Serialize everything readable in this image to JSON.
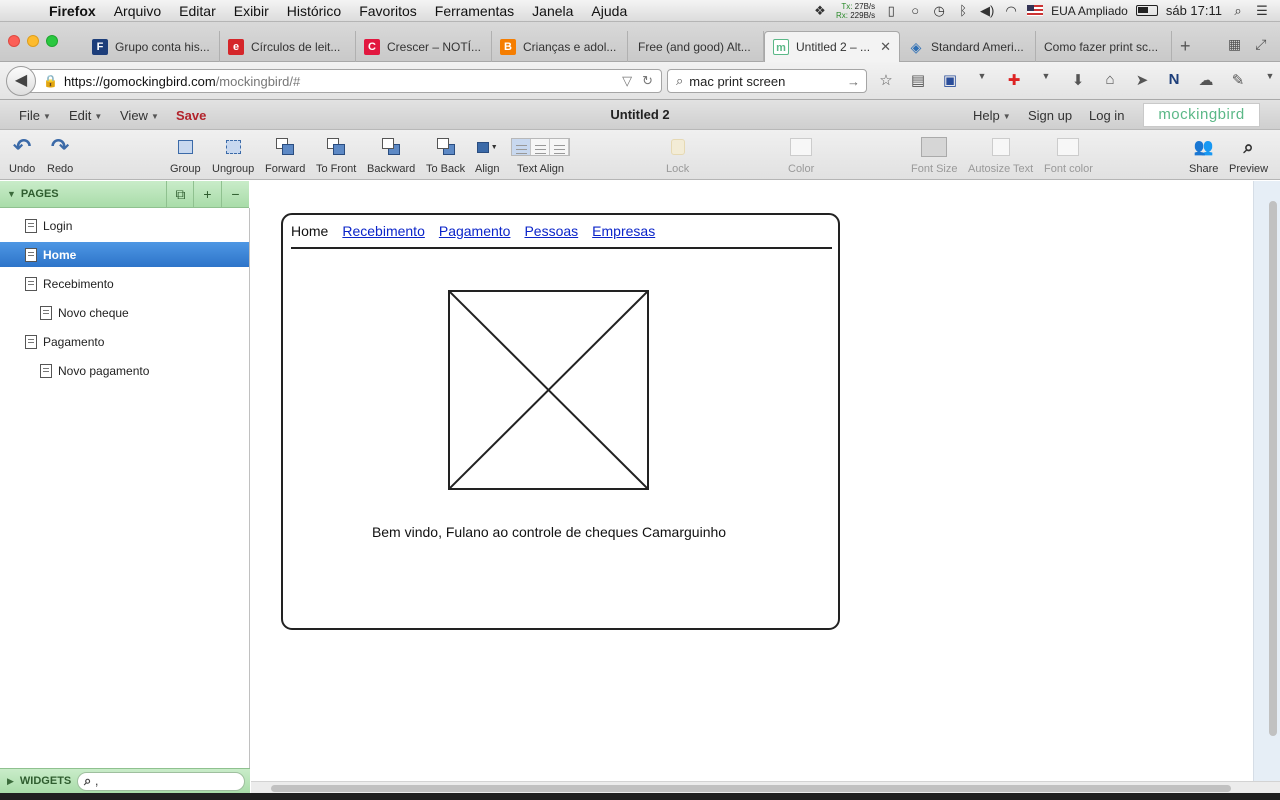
{
  "mac_menubar": {
    "app": "Firefox",
    "items": [
      "Arquivo",
      "Editar",
      "Exibir",
      "Histórico",
      "Favoritos",
      "Ferramentas",
      "Janela",
      "Ajuda"
    ],
    "net_tx_label": "Tx:",
    "net_rx_label": "Rx:",
    "net_tx": "27B/s",
    "net_rx": "229B/s",
    "keyboard": "EUA Ampliado",
    "clock": "sáb 17:11"
  },
  "tabs": [
    {
      "title": "Grupo conta his...",
      "favicon_text": "F",
      "favicon_color": "#1d3e7a"
    },
    {
      "title": "Círculos de leit...",
      "favicon_text": "e",
      "favicon_color": "#d5262a"
    },
    {
      "title": "Crescer – NOTÍ...",
      "favicon_text": "C",
      "favicon_color": "#e2173f"
    },
    {
      "title": "Crianças e adol...",
      "favicon_text": "B",
      "favicon_color": "#f57d00"
    },
    {
      "title": "Free (and good) Alt...",
      "favicon_text": "",
      "favicon_color": ""
    },
    {
      "title": "Untitled 2 – ...",
      "favicon_text": "m",
      "favicon_color": "#5bb887",
      "active": true
    },
    {
      "title": "Standard Ameri...",
      "favicon_text": "◈",
      "favicon_color": "#2e6fb5"
    },
    {
      "title": "Como fazer print sc...",
      "favicon_text": "",
      "favicon_color": ""
    }
  ],
  "tab_close": "✕",
  "new_tab": "+",
  "url": {
    "host": "https://gomockingbird.com",
    "path": "/mockingbird/#"
  },
  "search": {
    "value": "mac print screen"
  },
  "app_menu": {
    "file": "File",
    "edit": "Edit",
    "view": "View",
    "save": "Save",
    "doc_title": "Untitled 2",
    "help": "Help",
    "signup": "Sign up",
    "login": "Log in",
    "brand": "mockingbird"
  },
  "toolbar": {
    "undo": "Undo",
    "redo": "Redo",
    "group": "Group",
    "ungroup": "Ungroup",
    "forward": "Forward",
    "to_front": "To Front",
    "backward": "Backward",
    "to_back": "To Back",
    "align": "Align",
    "text_align": "Text Align",
    "lock": "Lock",
    "color": "Color",
    "font_size": "Font Size",
    "autosize_text": "Autosize Text",
    "font_color": "Font color",
    "share": "Share",
    "preview": "Preview"
  },
  "pages_panel": {
    "title": "PAGES",
    "add": "+",
    "remove": "−",
    "items": [
      {
        "label": "Login",
        "level": 0
      },
      {
        "label": "Home",
        "level": 0,
        "active": true
      },
      {
        "label": "Recebimento",
        "level": 0
      },
      {
        "label": "Novo cheque",
        "level": 1
      },
      {
        "label": "Pagamento",
        "level": 0
      },
      {
        "label": "Novo pagamento",
        "level": 1
      }
    ]
  },
  "widgets_panel": {
    "title": "WIDGETS",
    "search_value": ","
  },
  "mockup": {
    "nav_current": "Home",
    "nav_links": [
      "Recebimento",
      "Pagamento",
      "Pessoas",
      "Empresas"
    ],
    "welcome_text": "Bem vindo, Fulano ao controle de cheques Camarguinho"
  },
  "colors": {
    "accent_blue": "#2d74c9",
    "panel_green": "#a9dca9",
    "save_red": "#b2232b",
    "brand_green": "#5bb887",
    "link_blue": "#0b24c9"
  }
}
